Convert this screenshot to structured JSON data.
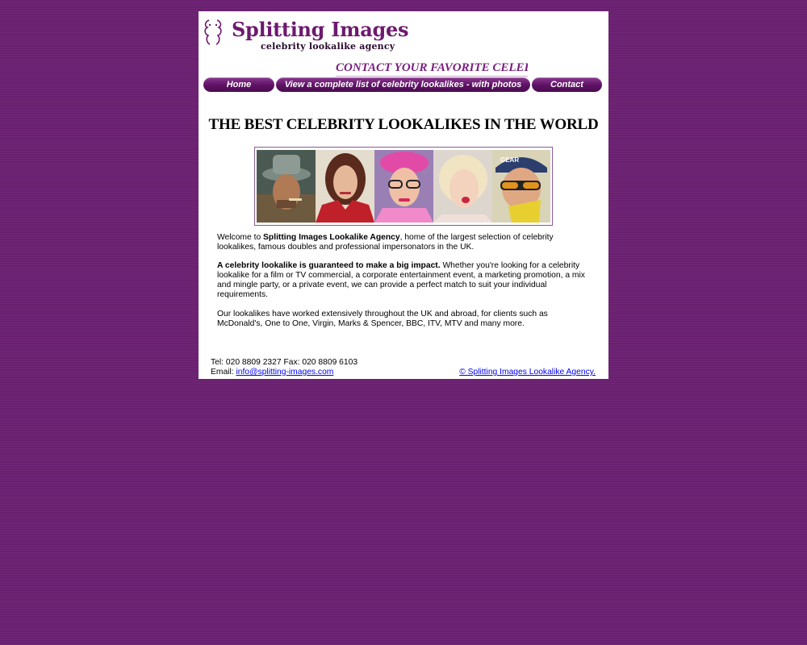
{
  "logo": {
    "title": "Splitting Images",
    "subtitle": "celebrity lookalike agency"
  },
  "banner": {
    "text": "CONTACT YOUR FAVORITE CELEBRITY LOOKALIKE TODAY"
  },
  "nav": {
    "home": "Home",
    "list": "View a complete list of celebrity lookalikes - with photos",
    "contact": "Contact"
  },
  "headline": "THE BEST CELEBRITY LOOKALIKES IN THE WORLD",
  "intro": {
    "p1_pre": "Welcome to ",
    "p1_bold": "Splitting Images Lookalike Agency",
    "p1_post": ", home of the largest selection of celebrity lookalikes, famous doubles and professional impersonators in the UK.",
    "p2_bold": "A celebrity lookalike is guaranteed to make a big impact.",
    "p2_post": " Whether you're looking for a celebrity lookalike for a film or TV commercial, a corporate entertainment event, a marketing promotion, a mix and mingle party, or a private event, we can provide a perfect match to suit your individual requirements.",
    "p3": "Our lookalikes have worked extensively throughout the UK and abroad, for clients such as McDonald's, One to One, Virgin, Marks & Spencer, BBC, ITV, MTV and many more."
  },
  "footer": {
    "tel": "Tel: 020 8809 2327  Fax: 020 8809 6103",
    "email_label": "Email: ",
    "email": "info@splitting-images.com",
    "copyright": "© Splitting Images Lookalike Agency."
  },
  "photo_caption_text": "GEAR",
  "colors": {
    "background": "#6a2070",
    "brand_purple": "#6d1a6e",
    "nav_button": "#5e1164",
    "link": "#0000ee"
  }
}
